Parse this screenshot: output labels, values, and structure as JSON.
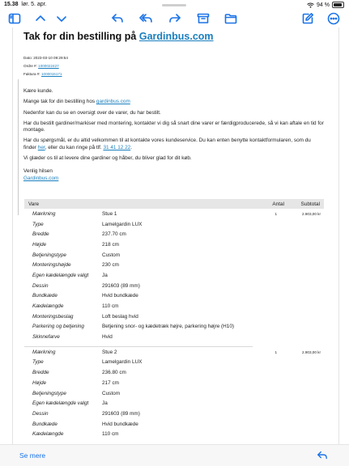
{
  "status_bar": {
    "time": "15.38",
    "date": "lør. 5. apr.",
    "battery": "94 %",
    "battery_level": 0.94
  },
  "toolbar": {
    "icons": [
      "sidebar-icon",
      "chevron-up-icon",
      "chevron-down-icon",
      "reply-icon",
      "reply-all-icon",
      "forward-icon",
      "archive-icon",
      "folder-icon",
      "compose-icon",
      "more-icon"
    ]
  },
  "email": {
    "title_prefix": "Tak for din bestilling på",
    "title_link": "Gardinbus.com",
    "date_line": "Dato: 2023-03-10 09:29:54",
    "order_label": "Ordre #:",
    "order_number": "1000022427",
    "invoice_label": "Faktura #:",
    "invoice_number": "1000015171",
    "greeting": "Kære kunde.",
    "thanks_text": "Mange tak for din bestilling hos",
    "thanks_link": "gardinbus.com",
    "overview_text": "Nedenfor kan du se en oversigt over de varer, du har bestilt.",
    "installation_text": "Har du bestilt gardiner/markiser med montering, kontakter vi dig så snart dine varer er færdigproducerede, så vi kan aftale en tid for montage.",
    "questions_text_1": "Har du spørgsmål, er du altid velkommen til at kontakte vores kundeservice. Du kan enten benytte kontaktformularen, som du finder",
    "questions_link_here": "her",
    "questions_text_2": ", eller du kan ringe på tlf.",
    "phone": "31 41 12 22",
    "questions_text_end": ".",
    "closing_text": "Vi glæder os til at levere dine gardiner og håber, du bliver glad for dit køb.",
    "signoff": "Venlig hilsen",
    "signature_link": "Gardinbus.com"
  },
  "order_table": {
    "headers": {
      "item": "Vare",
      "qty": "Antal",
      "subtotal": "Subtotal"
    },
    "items": [
      {
        "qty": "1",
        "subtotal": "2.903,00 kr",
        "rows": [
          {
            "label": "Mærkning",
            "value": "Stue 1"
          },
          {
            "label": "Type",
            "value": "Lamelgardin LUX"
          },
          {
            "label": "Bredde",
            "value": "237.70 cm"
          },
          {
            "label": "Højde",
            "value": "218 cm"
          },
          {
            "label": "Betjeningstype",
            "value": "Custom"
          },
          {
            "label": "Monteringshøjde",
            "value": "230 cm"
          },
          {
            "label": "Egen kædelængde valgt",
            "value": "Ja"
          },
          {
            "label": "Dessin",
            "value": "291603 (89 mm)"
          },
          {
            "label": "Bundkæde",
            "value": "Hvid bundkæde"
          },
          {
            "label": "Kædelængde",
            "value": "110 cm"
          },
          {
            "label": "Monteringsbeslag",
            "value": "Loft beslag hvid"
          },
          {
            "label": "Parkering og betjening",
            "value": "Betjening snor- og kædetræk højre, parkering højre (H10)"
          },
          {
            "label": "Skinnefarve",
            "value": "Hvid"
          }
        ]
      },
      {
        "qty": "1",
        "subtotal": "2.903,00 kr",
        "rows": [
          {
            "label": "Mærkning",
            "value": "Stue 2"
          },
          {
            "label": "Type",
            "value": "Lamelgardin LUX"
          },
          {
            "label": "Bredde",
            "value": "236.80 cm"
          },
          {
            "label": "Højde",
            "value": "217 cm"
          },
          {
            "label": "Betjeningstype",
            "value": "Custom"
          },
          {
            "label": "Egen kædelængde valgt",
            "value": "Ja"
          },
          {
            "label": "Dessin",
            "value": "291603 (89 mm)"
          },
          {
            "label": "Bundkæde",
            "value": "Hvid bundkæde"
          },
          {
            "label": "Kædelængde",
            "value": "110 cm"
          }
        ]
      }
    ]
  },
  "bottom_bar": {
    "see_more": "Se mere"
  },
  "colors": {
    "accent": "#1a73e8",
    "link": "#1a7fbf",
    "table_header_bg": "#e6e6e6"
  }
}
